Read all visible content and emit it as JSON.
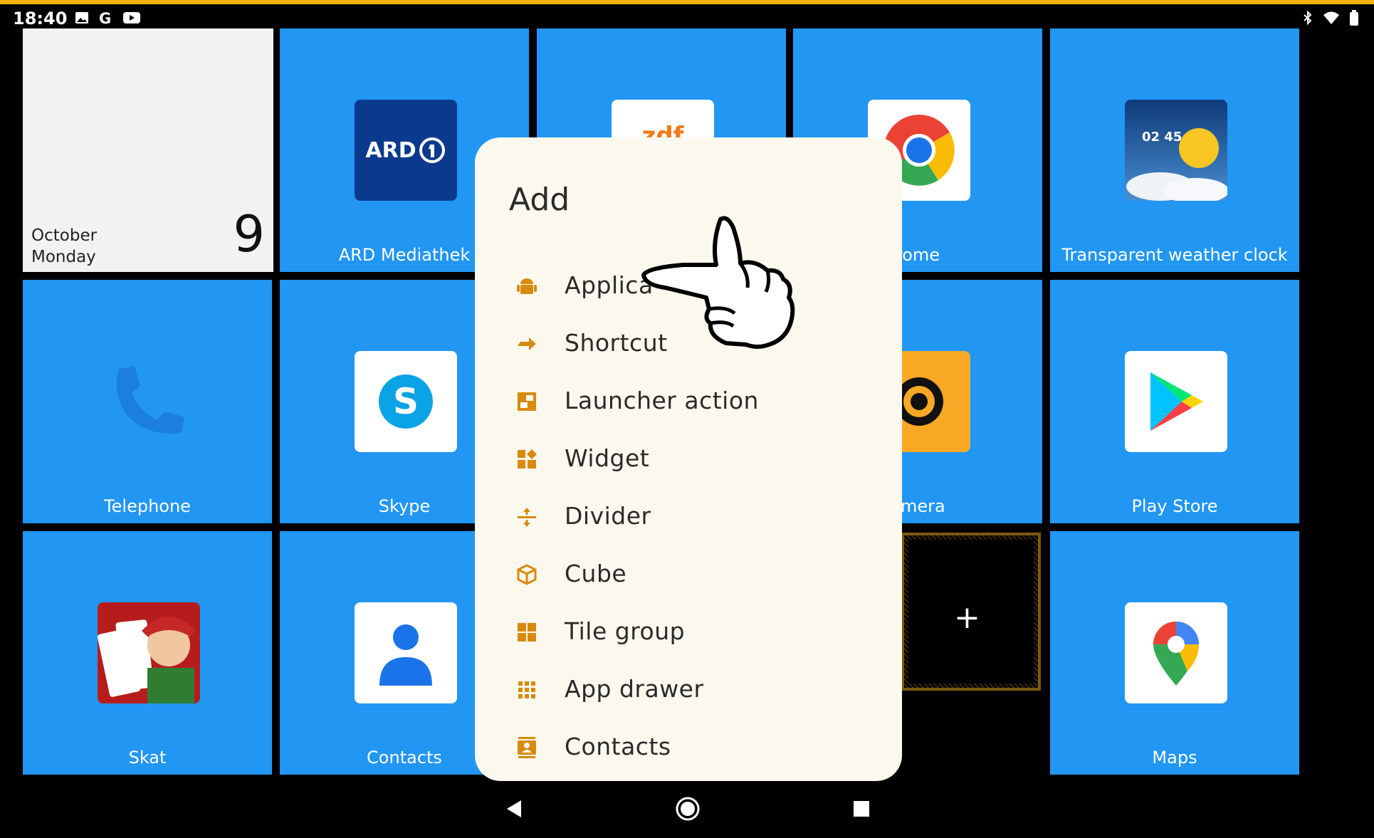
{
  "status_bar": {
    "time": "18:40",
    "left_icons": [
      "image-icon",
      "google-icon",
      "youtube-icon"
    ],
    "right_icons": [
      "bluetooth-icon",
      "wifi-icon",
      "battery-icon"
    ]
  },
  "calendar_tile": {
    "month": "October",
    "weekday": "Monday",
    "day": "9"
  },
  "tiles": {
    "ard": "ARD Mediathek",
    "ard_logo": "ARD",
    "zdf_logo": "zdf",
    "chrome": "rome",
    "weather": "Transparent weather clock",
    "weather_time": "02 45",
    "telephone": "Telephone",
    "skype": "Skype",
    "camera": "amera",
    "play": "Play Store",
    "skat": "Skat",
    "contacts": "Contacts",
    "maps": "Maps"
  },
  "add_tile": {
    "symbol": "+"
  },
  "dialog": {
    "title": "Add",
    "items": [
      {
        "label": "Applica",
        "icon": "android-icon"
      },
      {
        "label": "Shortcut",
        "icon": "shortcut-arrow-icon"
      },
      {
        "label": "Launcher action",
        "icon": "launcher-action-icon"
      },
      {
        "label": "Widget",
        "icon": "widget-icon"
      },
      {
        "label": "Divider",
        "icon": "divider-icon"
      },
      {
        "label": "Cube",
        "icon": "cube-icon"
      },
      {
        "label": "Tile group",
        "icon": "tile-group-icon"
      },
      {
        "label": "App drawer",
        "icon": "app-drawer-icon"
      },
      {
        "label": "Contacts",
        "icon": "contacts-icon"
      }
    ]
  },
  "colors": {
    "tile": "#2196f3",
    "accent": "#e08a00",
    "dialog_bg": "#fbf8ee"
  }
}
